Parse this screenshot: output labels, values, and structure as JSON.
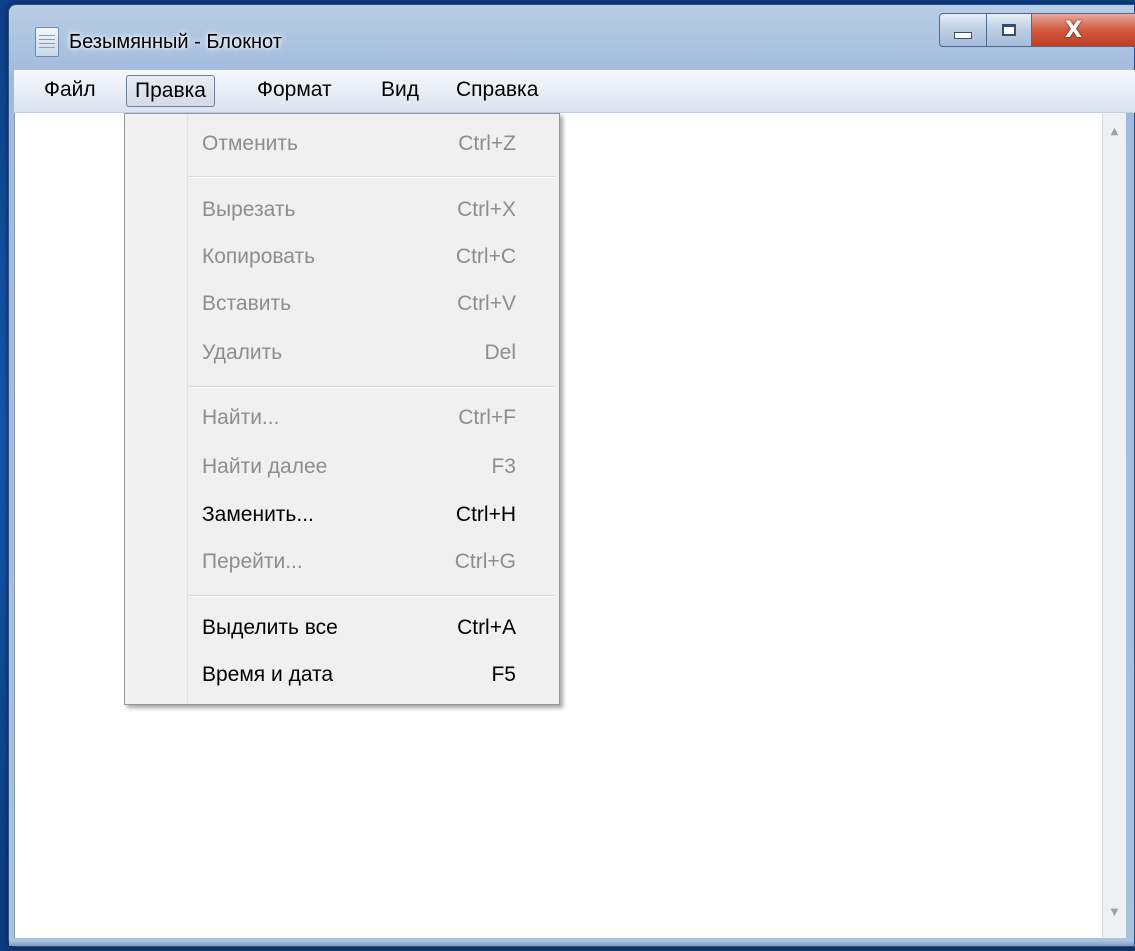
{
  "window": {
    "title": "Безымянный - Блокнот",
    "icon": "notepad-icon",
    "controls": {
      "minimize_icon": "minimize-icon",
      "maximize_icon": "maximize-icon",
      "close_glyph": "X"
    }
  },
  "menubar": {
    "items": [
      "Файл",
      "Правка",
      "Формат",
      "Вид",
      "Справка"
    ],
    "active": "Правка"
  },
  "edit_menu": {
    "groups": [
      [
        {
          "label": "Отменить",
          "shortcut": "Ctrl+Z",
          "enabled": false
        }
      ],
      [
        {
          "label": "Вырезать",
          "shortcut": "Ctrl+X",
          "enabled": false
        },
        {
          "label": "Копировать",
          "shortcut": "Ctrl+C",
          "enabled": false
        },
        {
          "label": "Вставить",
          "shortcut": "Ctrl+V",
          "enabled": false
        },
        {
          "label": "Удалить",
          "shortcut": "Del",
          "enabled": false
        }
      ],
      [
        {
          "label": "Найти...",
          "shortcut": "Ctrl+F",
          "enabled": false
        },
        {
          "label": "Найти далее",
          "shortcut": "F3",
          "enabled": false
        },
        {
          "label": "Заменить...",
          "shortcut": "Ctrl+H",
          "enabled": true
        },
        {
          "label": "Перейти...",
          "shortcut": "Ctrl+G",
          "enabled": false
        }
      ],
      [
        {
          "label": "Выделить все",
          "shortcut": "Ctrl+A",
          "enabled": true
        },
        {
          "label": "Время и дата",
          "shortcut": "F5",
          "enabled": true
        }
      ]
    ]
  },
  "editor": {
    "text": ""
  },
  "colors": {
    "desktop": "#1455a8",
    "menu_background": "#f0f0f0",
    "disabled_text": "#8d8d8d",
    "enabled_text": "#000000",
    "close_button": "#c23c1f"
  }
}
